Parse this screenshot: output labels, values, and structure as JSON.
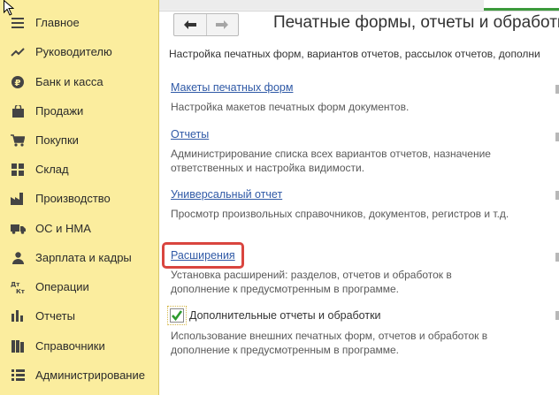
{
  "sidebar": {
    "items": [
      {
        "label": "Главное",
        "icon": "menu-icon"
      },
      {
        "label": "Руководителю",
        "icon": "trend-icon"
      },
      {
        "label": "Банк и касса",
        "icon": "ruble-icon"
      },
      {
        "label": "Продажи",
        "icon": "bag-icon"
      },
      {
        "label": "Покупки",
        "icon": "cart-icon"
      },
      {
        "label": "Склад",
        "icon": "warehouse-icon"
      },
      {
        "label": "Производство",
        "icon": "factory-icon"
      },
      {
        "label": "ОС и НМА",
        "icon": "truck-icon"
      },
      {
        "label": "Зарплата и кадры",
        "icon": "person-icon"
      },
      {
        "label": "Операции",
        "icon": "dt-kt-icon",
        "icon_text_top": "Дт",
        "icon_text_bottom": "Кт"
      },
      {
        "label": "Отчеты",
        "icon": "bar-chart-icon"
      },
      {
        "label": "Справочники",
        "icon": "book-icon"
      },
      {
        "label": "Администрирование",
        "icon": "settings-list-icon"
      }
    ]
  },
  "header": {
    "title": "Печатные формы, отчеты и обработки"
  },
  "main": {
    "subtitle": "Настройка печатных форм, вариантов отчетов, рассылок отчетов, дополни",
    "sections": [
      {
        "link": "Макеты печатных форм",
        "desc_lines": [
          "Настройка макетов печатных форм документов."
        ]
      },
      {
        "link": "Отчеты",
        "desc_lines": [
          "Администрирование списка всех вариантов отчетов, назначение",
          "ответственных и настройка видимости."
        ]
      },
      {
        "link": "Универсальный отчет",
        "desc_lines": [
          "Просмотр произвольных справочников, документов, регистров и т.д."
        ]
      },
      {
        "link": "Расширения",
        "desc_lines": [
          "Установка расширений: разделов, отчетов и обработок в",
          "дополнение к предусмотренным в программе."
        ]
      }
    ],
    "checkbox": {
      "label": "Дополнительные отчеты и обработки",
      "checked": true,
      "desc_lines": [
        "Использование внешних печатных форм, отчетов и обработок в",
        "дополнение к предусмотренным в программе."
      ]
    }
  },
  "colors": {
    "sidebar_bg": "#fbed9e",
    "link": "#2f59a6",
    "highlight": "#d9453f",
    "check": "#2e9b2e"
  }
}
